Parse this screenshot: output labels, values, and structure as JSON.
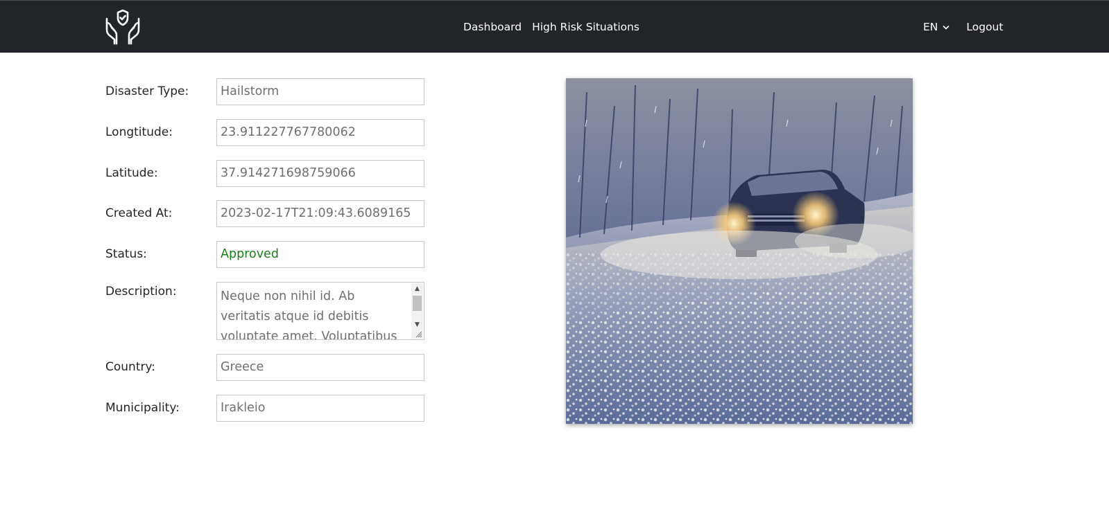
{
  "nav": {
    "links": [
      "Dashboard",
      "High Risk Situations"
    ],
    "language": "EN",
    "logout": "Logout",
    "logo_icon": "hands-shield-icon"
  },
  "form": {
    "fields": [
      {
        "label": "Disaster Type:",
        "value": "Hailstorm"
      },
      {
        "label": "Longtitude:",
        "value": "23.911227767780062"
      },
      {
        "label": "Latitude:",
        "value": "37.914271698759066"
      },
      {
        "label": "Created At:",
        "value": "2023-02-17T21:09:43.6089165"
      },
      {
        "label": "Status:",
        "value": "Approved"
      },
      {
        "label": "Description:",
        "value": "Neque non nihil id. Ab veritatis atque id debitis voluptate amet. Voluptatibus fuga saepe veniam"
      },
      {
        "label": "Country:",
        "value": "Greece"
      },
      {
        "label": "Municipality:",
        "value": "Irakleio"
      }
    ]
  },
  "colors": {
    "navbar": "#212529",
    "status_approved": "#1a7d1a",
    "field_border": "#c6c6c6"
  }
}
